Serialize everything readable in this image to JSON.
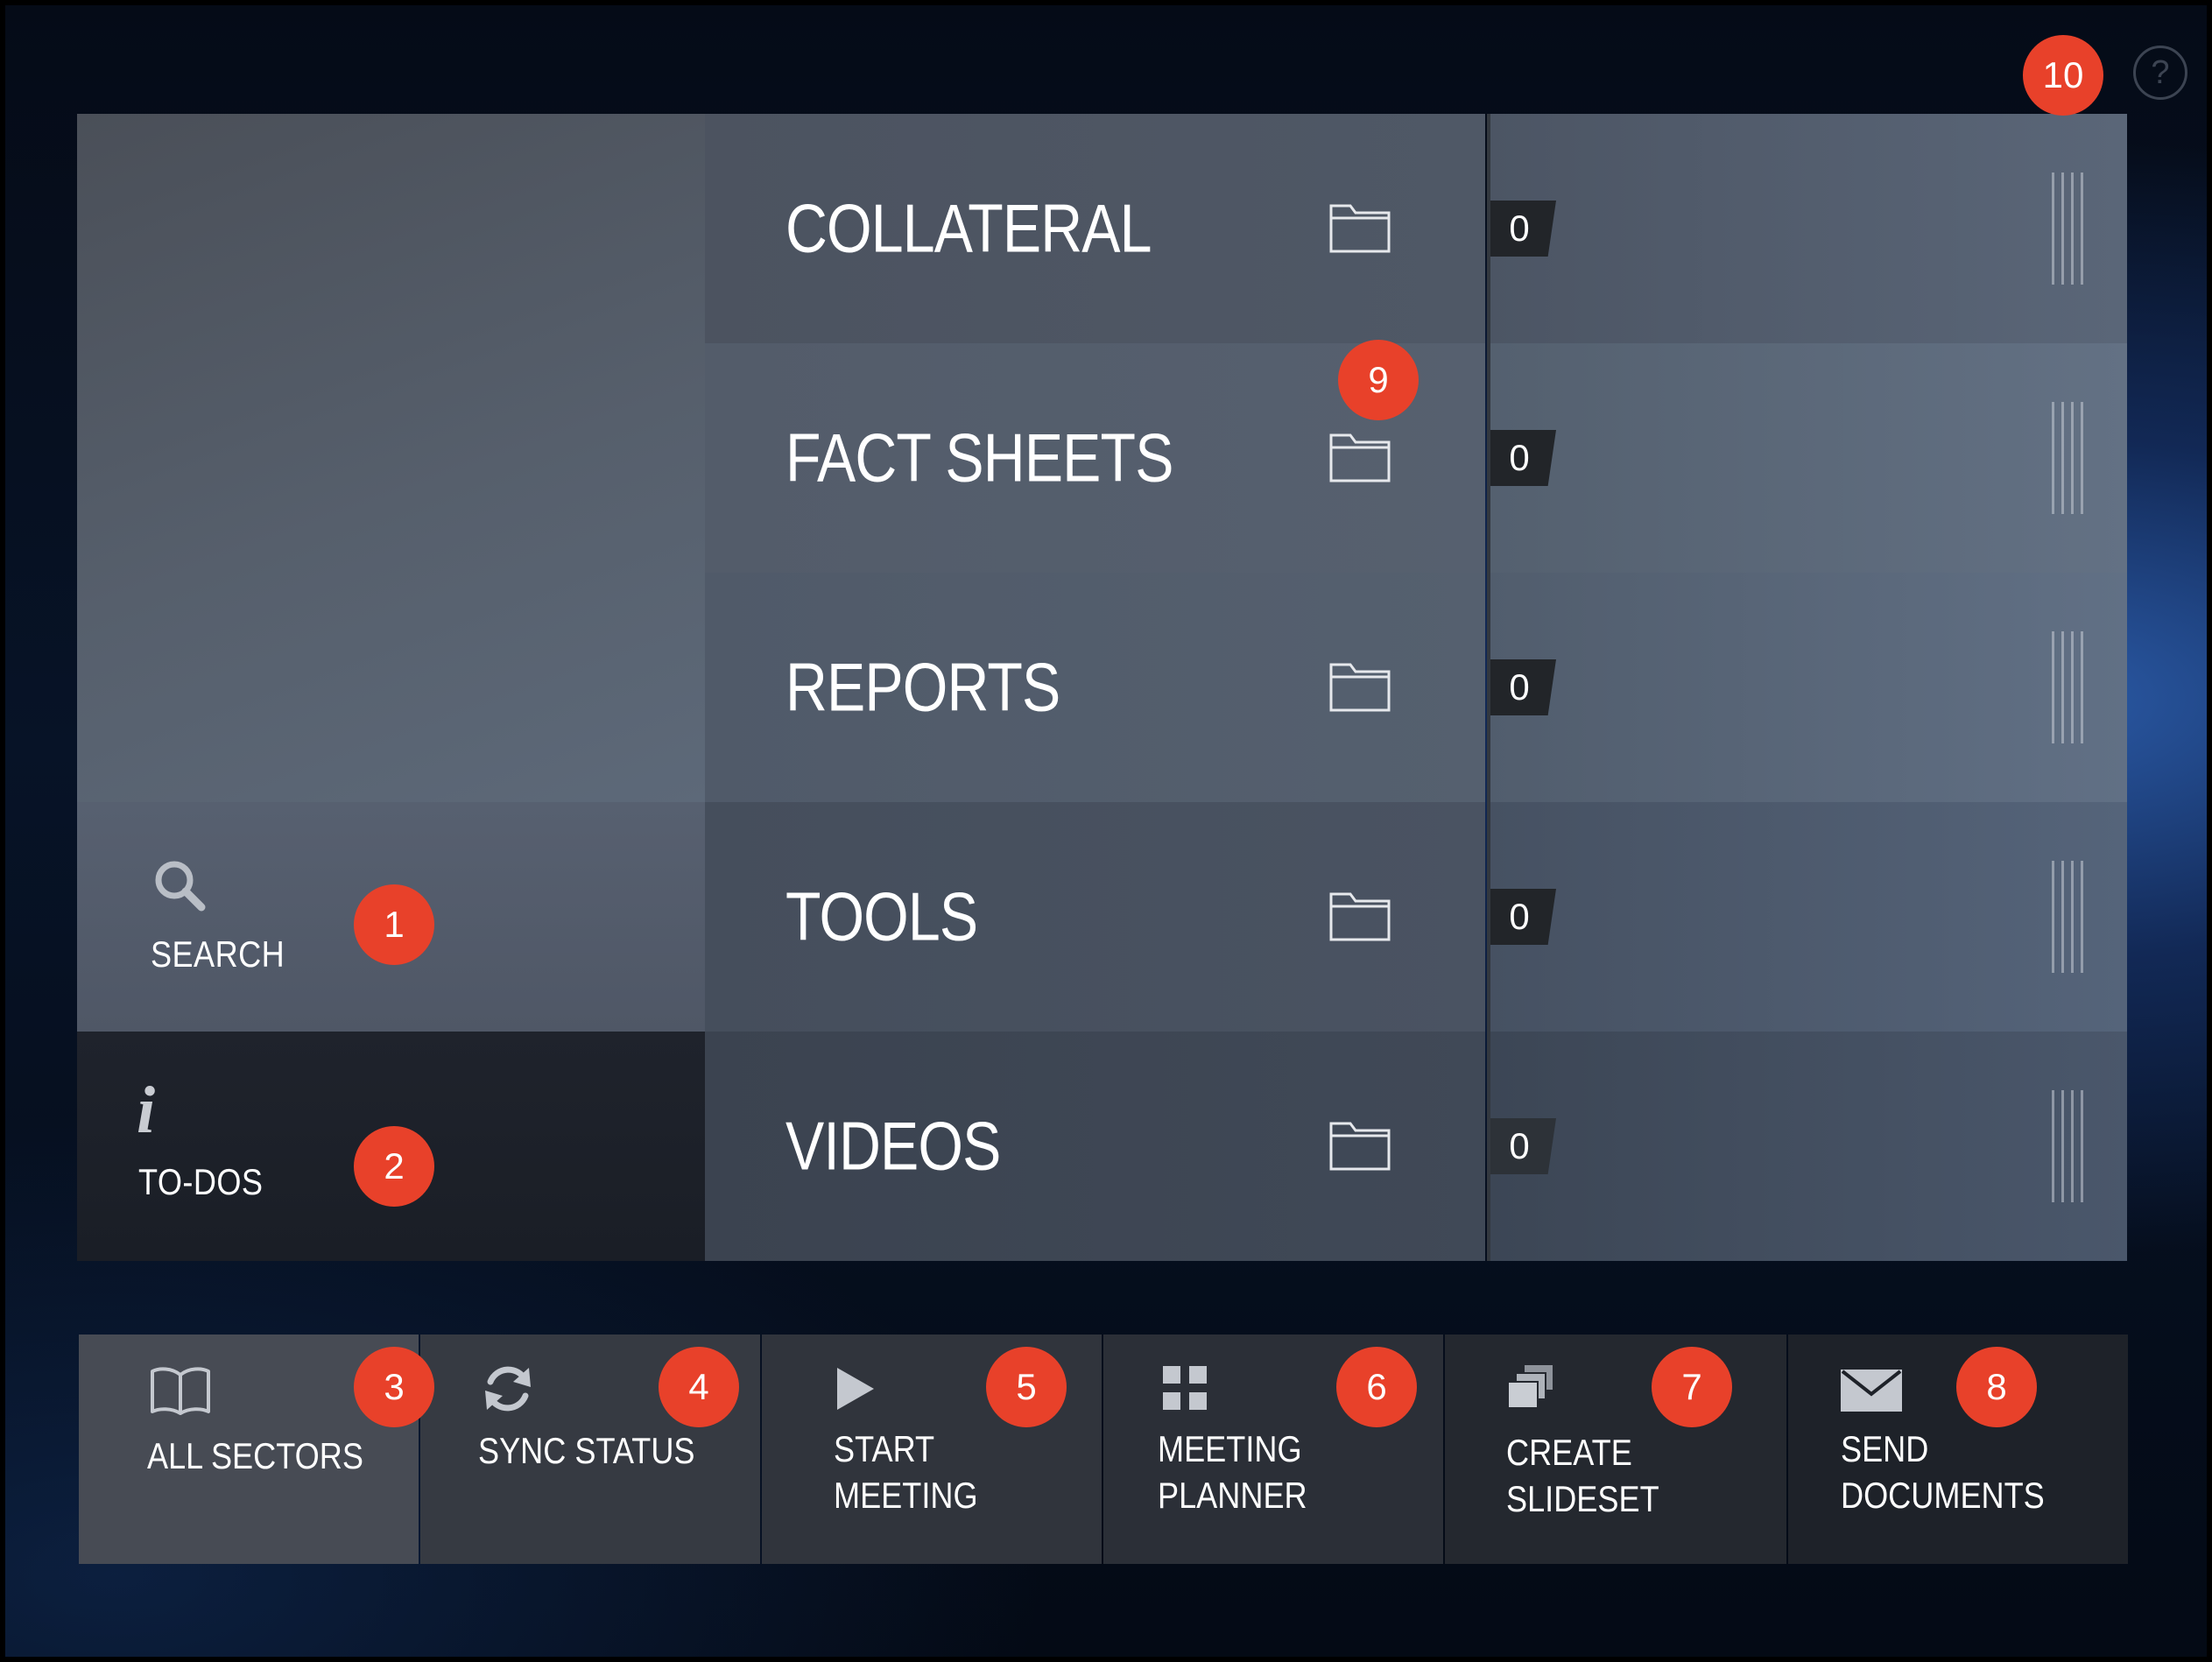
{
  "help": {
    "glyph": "?"
  },
  "sidebar": {
    "search_label": "SEARCH",
    "todos_label": "TO-DOS",
    "todos_glyph": "i"
  },
  "categories": [
    {
      "title": "COLLATERAL",
      "count": "0"
    },
    {
      "title": "FACT SHEETS",
      "count": "0"
    },
    {
      "title": "REPORTS",
      "count": "0"
    },
    {
      "title": "TOOLS",
      "count": "0"
    },
    {
      "title": "VIDEOS",
      "count": "0"
    }
  ],
  "toolbar": [
    {
      "line1": "ALL SECTORS",
      "line2": "",
      "icon": "book-icon"
    },
    {
      "line1": "SYNC STATUS",
      "line2": "",
      "icon": "sync-icon"
    },
    {
      "line1": "START",
      "line2": "MEETING",
      "icon": "play-icon"
    },
    {
      "line1": "MEETING",
      "line2": "PLANNER",
      "icon": "grid-icon"
    },
    {
      "line1": "CREATE",
      "line2": "SLIDESET",
      "icon": "stack-icon"
    },
    {
      "line1": "SEND",
      "line2": "DOCUMENTS",
      "icon": "envelope-icon"
    }
  ],
  "badges": [
    "1",
    "2",
    "3",
    "4",
    "5",
    "6",
    "7",
    "8",
    "9",
    "10"
  ],
  "colors": {
    "badge": "#e8412a",
    "background": "#071327",
    "panel": "#525a66",
    "toolbar": "#2a2e36"
  }
}
